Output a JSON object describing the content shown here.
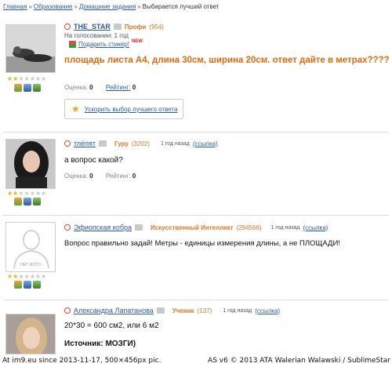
{
  "breadcrumb": {
    "items": [
      "Главная",
      "Образование",
      "Домашние задания"
    ],
    "current": "Выбирается лучший ответ",
    "separator": "»"
  },
  "question": {
    "username": "THE_STAR",
    "rank": "Профи",
    "rank_count": "(954)",
    "voting_label": "На голосовании: 1 год",
    "gift_label": "Подарить стикер!",
    "gift_badge": "NEW",
    "text": "площадь листа А4, длина 30см, ширина 20см. ответ дайте в метрах????",
    "score_label": "Оценка:",
    "score_value": "0",
    "rating_label": "Рейтинг:",
    "rating_value": "0",
    "speedup_button": "Ускорить выбор лучшего ответа",
    "stars": 2
  },
  "answers": [
    {
      "username": "тлёпят",
      "rank": "Гуру",
      "rank_count": "(3202)",
      "time": "1 год назад",
      "link": "(ссылка)",
      "text": "а вопрос какой?",
      "score_label": "Оценка:",
      "score_value": "0",
      "rating_label": "Рейтинг:",
      "rating_value": "0",
      "stars": 2
    },
    {
      "username": "Эфиопская кобра",
      "rank": "Искусственный Интеллект",
      "rank_count": "(294566)",
      "time": "1 год назад",
      "link": "(ссылка)",
      "text": "Вопрос правильно задай! Метры - единицы измерения длины, а не ПЛОЩАДИ!",
      "no_photo": "НЕТ ФОТО",
      "stars": 2
    },
    {
      "username": "Александра Лапатанова",
      "rank": "Ученик",
      "rank_count": "(137)",
      "time": "1 год назад",
      "link": "(ссылка)",
      "text": "20*30 = 600 см2, или 6 м2",
      "source": "Источник: МОЗГИ)"
    }
  ],
  "footer": {
    "left": "At im9.eu since 2013-11-17, 500×456px pic.",
    "right": "AS v6 © 2013 ATA Walerian Walawski / SublimeStar"
  },
  "colors": {
    "link": "#2b5aa6",
    "rank": "#e0752b",
    "question_text": "#e06a10",
    "star_on": "#e8b417"
  }
}
